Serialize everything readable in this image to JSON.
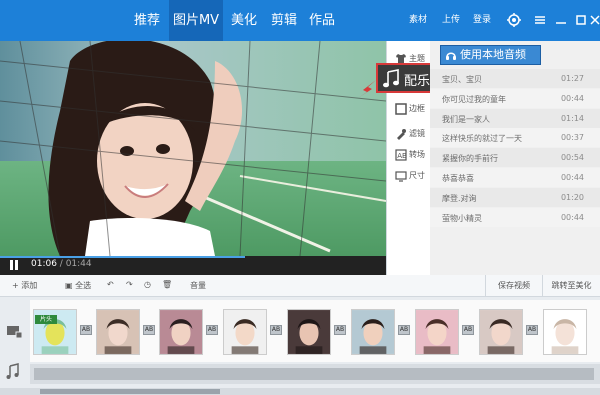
{
  "topnav": {
    "tabs": [
      {
        "label": "推荐"
      },
      {
        "label": "图片MV"
      },
      {
        "label": "美化"
      },
      {
        "label": "剪辑"
      },
      {
        "label": "作品"
      }
    ],
    "actions": [
      {
        "label": "素材"
      },
      {
        "label": "上传"
      },
      {
        "label": "登录"
      }
    ],
    "icons": [
      "settings-icon",
      "menu-icon",
      "minimize-icon",
      "maximize-icon",
      "close-icon"
    ]
  },
  "player": {
    "current_time": "01:06",
    "total_time": " / 01:44",
    "progress": 0.635
  },
  "side_menu": {
    "items": [
      {
        "label": "主题",
        "icon": "shirt-icon"
      },
      {
        "label": "配乐",
        "icon": "music-note-icon"
      },
      {
        "label": "边框",
        "icon": "frame-icon"
      },
      {
        "label": "滤镜",
        "icon": "filter-icon"
      },
      {
        "label": "转场",
        "icon": "transition-icon"
      },
      {
        "label": "尺寸",
        "icon": "monitor-icon"
      }
    ],
    "active_label": "配乐"
  },
  "music_panel": {
    "local_button": "使用本地音频",
    "tracks": [
      {
        "name": "宝贝、宝贝",
        "duration": "01:27"
      },
      {
        "name": "你可见过我的童年",
        "duration": "00:44"
      },
      {
        "name": "我们是一家人",
        "duration": "01:14"
      },
      {
        "name": "这样快乐的就过了一天",
        "duration": "00:37"
      },
      {
        "name": "紧握你的手前行",
        "duration": "00:54"
      },
      {
        "name": "恭喜恭喜",
        "duration": "00:44"
      },
      {
        "name": "摩登.对询",
        "duration": "01:20"
      },
      {
        "name": "萤物小精灵",
        "duration": "00:44"
      }
    ]
  },
  "toolbar": {
    "add": "添加",
    "select_all": "全选",
    "volume": "音量",
    "save_video": "保存视频",
    "jump": "跳转至美化"
  },
  "timeline": {
    "opening_label": "片头",
    "ab_label": "AB",
    "colors": {
      "accent": "#1d80d8",
      "active_nav": "#1567b8",
      "highlight": "#d83a3a"
    }
  }
}
